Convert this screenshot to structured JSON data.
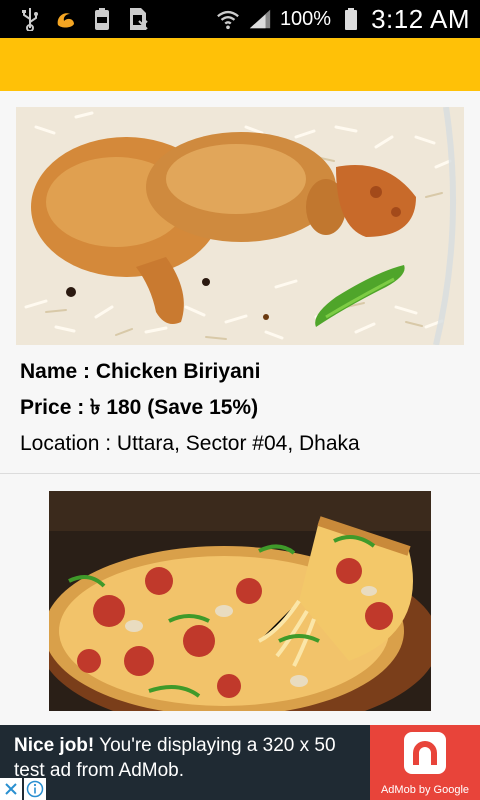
{
  "status_bar": {
    "battery_percent": "100%",
    "time": "3:12 AM",
    "icons": [
      "usb-icon",
      "uc-browser-icon",
      "battery-100-notification-icon",
      "sim-icon",
      "wifi-icon",
      "signal-icon",
      "battery-icon"
    ]
  },
  "toolbar": {
    "color": "#FFC107"
  },
  "items": [
    {
      "name_label": "Name : Chicken Biriyani",
      "price_label": "Price : ৳ 180 (Save 15%)",
      "location_label": "Location : Uttara, Sector #04, Dhaka",
      "image": "chicken-biriyani-photo"
    },
    {
      "image": "pizza-photo"
    }
  ],
  "ad": {
    "headline": "Nice job!",
    "text": " You're displaying a 320 x 50 test ad from AdMob.",
    "brand": "AdMob by Google"
  }
}
